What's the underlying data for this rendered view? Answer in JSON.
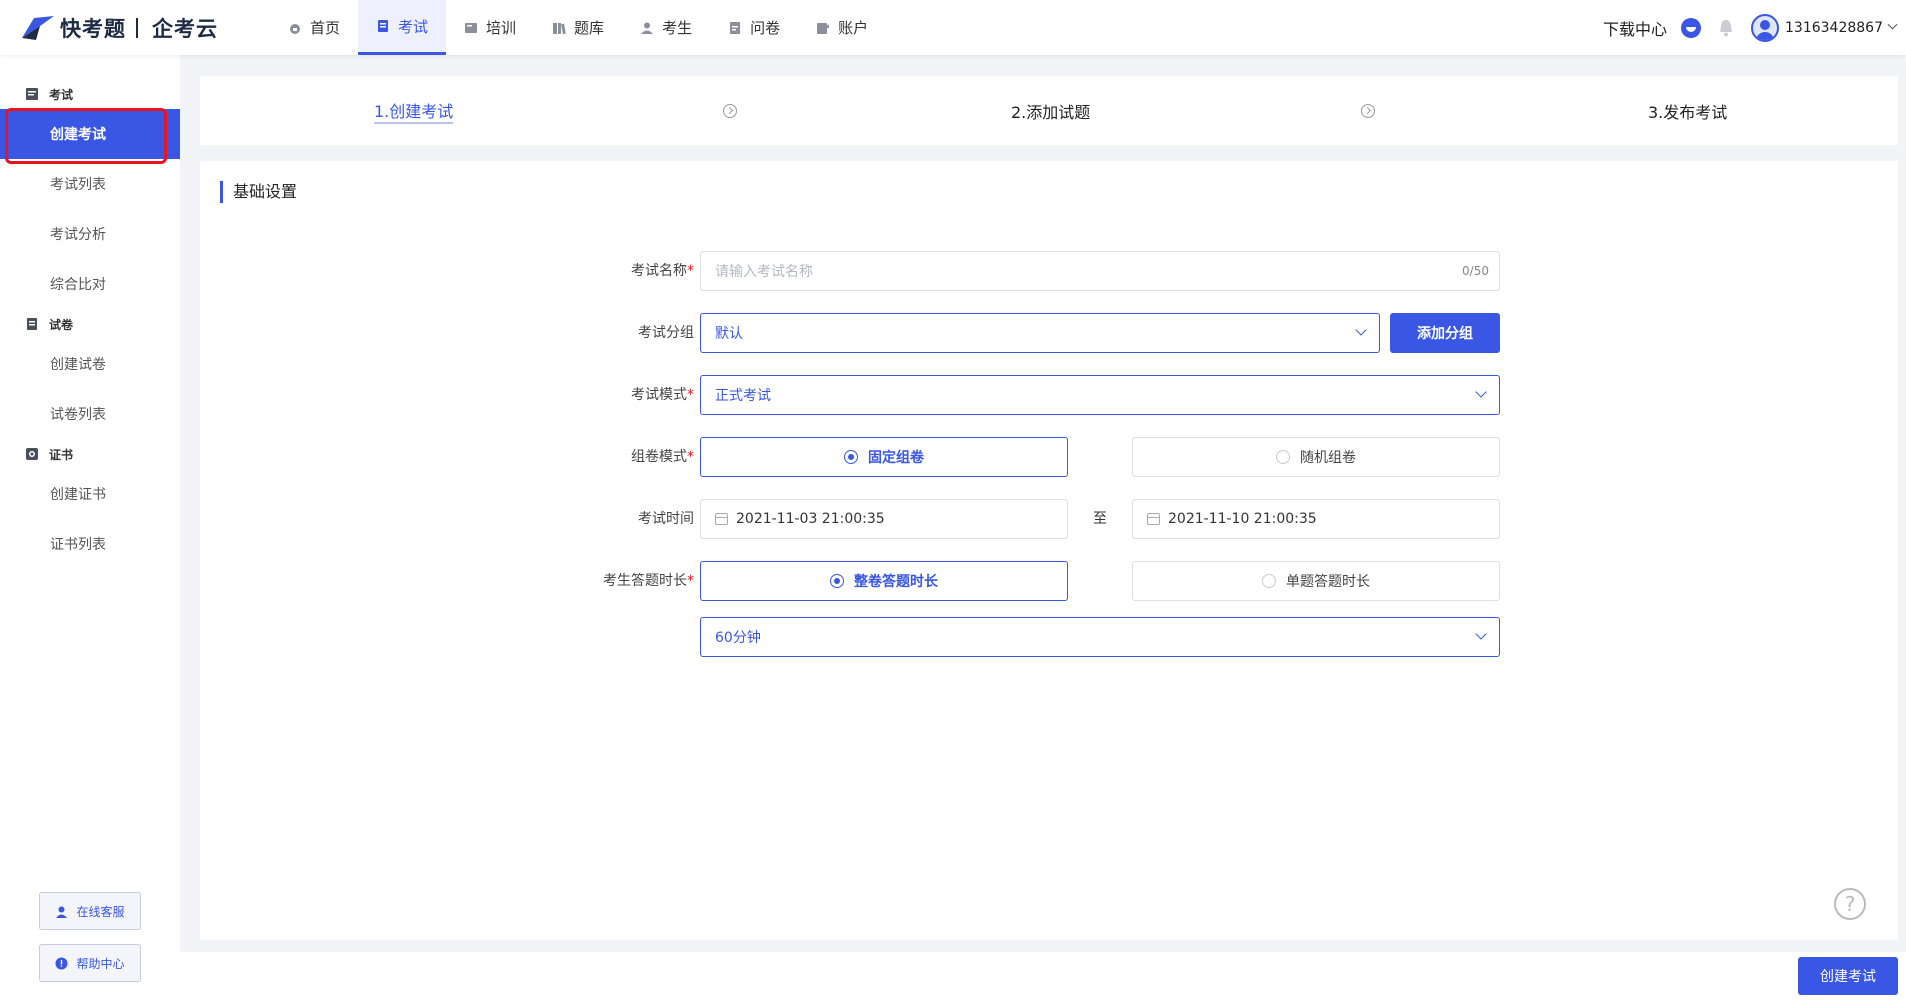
{
  "brand": {
    "name1": "快考题",
    "name2": "企考云"
  },
  "nav": {
    "items": [
      {
        "label": "首页",
        "icon": "home-icon"
      },
      {
        "label": "考试",
        "icon": "exam-icon",
        "active": true
      },
      {
        "label": "培训",
        "icon": "training-icon"
      },
      {
        "label": "题库",
        "icon": "question-bank-icon"
      },
      {
        "label": "考生",
        "icon": "user-icon"
      },
      {
        "label": "问卷",
        "icon": "survey-icon"
      },
      {
        "label": "账户",
        "icon": "account-icon"
      }
    ],
    "download": "下载中心",
    "phone": "13163428867"
  },
  "sidebar": {
    "groups": [
      {
        "label": "考试",
        "items": [
          "创建考试",
          "考试列表",
          "考试分析",
          "综合比对"
        ]
      },
      {
        "label": "试卷",
        "items": [
          "创建试卷",
          "试卷列表"
        ]
      },
      {
        "label": "证书",
        "items": [
          "创建证书",
          "证书列表"
        ]
      }
    ],
    "active": "创建考试",
    "service": "在线客服",
    "help": "帮助中心"
  },
  "steps": [
    "1.创建考试",
    "2.添加试题",
    "3.发布考试"
  ],
  "form": {
    "section_title": "基础设置",
    "name_label": "考试名称",
    "name_placeholder": "请输入考试名称",
    "name_counter": "0/50",
    "group_label": "考试分组",
    "group_value": "默认",
    "add_group": "添加分组",
    "mode_label": "考试模式",
    "mode_value": "正式考试",
    "compose_label": "组卷模式",
    "compose_fixed": "固定组卷",
    "compose_random": "随机组卷",
    "time_label": "考试时间",
    "time_start": "2021-11-03 21:00:35",
    "time_to": "至",
    "time_end": "2021-11-10 21:00:35",
    "duration_label": "考生答题时长",
    "duration_whole": "整卷答题时长",
    "duration_single": "单题答题时长",
    "duration_value": "60分钟"
  },
  "footer": {
    "create": "创建考试",
    "help_mark": "?"
  },
  "colors": {
    "accent": "#3a56e4",
    "highlight": "#e8141e"
  }
}
